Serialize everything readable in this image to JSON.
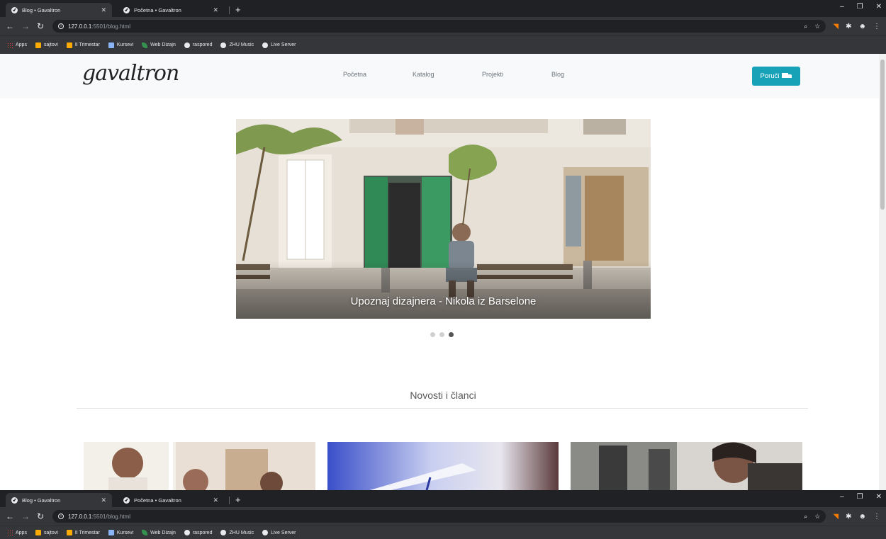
{
  "browser": {
    "tabs": [
      {
        "title": "Blog • Gavaltron",
        "active": true
      },
      {
        "title": "Početna • Gavaltron",
        "active": false
      }
    ],
    "url_host": "127.0.0.1",
    "url_rest": ":5501/blog.html",
    "bookmarks": [
      {
        "label": "Apps",
        "icon": "apps-icon"
      },
      {
        "label": "sajtovi",
        "icon": "folder-icon"
      },
      {
        "label": "II Trimestar",
        "icon": "folder-icon"
      },
      {
        "label": "Kursevi",
        "icon": "disk-icon"
      },
      {
        "label": "Web Dizajn",
        "icon": "leaf-icon"
      },
      {
        "label": "raspored",
        "icon": "globe-icon"
      },
      {
        "label": "ZHU Music",
        "icon": "check-icon"
      },
      {
        "label": "Live Server",
        "icon": "check-icon"
      }
    ]
  },
  "site": {
    "logo": "gavaltron",
    "nav": [
      "Početna",
      "Katalog",
      "Projekti",
      "Blog"
    ],
    "order_button": "Poruči",
    "carousel": {
      "caption": "Upoznaj dizajnera - Nikola iz Barselone",
      "slides": 3,
      "active_slide": 3
    },
    "section_title": "Novosti i članci"
  },
  "colors": {
    "chrome_dark": "#202124",
    "chrome_toolbar": "#35363a",
    "accent": "#17a2b8",
    "header_bg": "#f8f9fa"
  }
}
